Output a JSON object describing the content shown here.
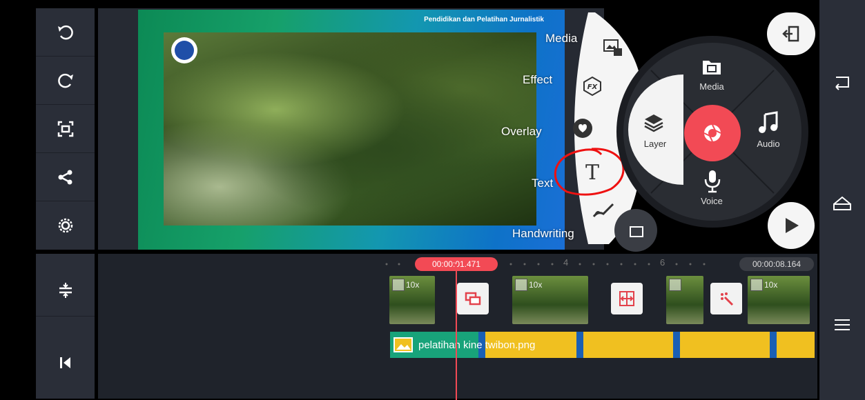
{
  "preview": {
    "title": "Pendidikan dan Pelatihan Jurnalistik"
  },
  "left_toolbar": {
    "items": [
      "undo-icon",
      "redo-icon",
      "crop-icon",
      "share-icon",
      "settings-icon",
      "align-icon",
      "skip-start-icon"
    ]
  },
  "arc_menu": {
    "media": "Media",
    "effect": "Effect",
    "overlay": "Overlay",
    "text": "Text",
    "handwriting": "Handwriting"
  },
  "main_menu": {
    "media": "Media",
    "audio": "Audio",
    "voice": "Voice",
    "layer": "Layer"
  },
  "timeline": {
    "current_time": "00:00:01.471",
    "total_time": "00:00:08.164",
    "marker_4": "4",
    "marker_6": "6",
    "clip_speed": "10x",
    "layer_name": "pelatihan kine twibon.png"
  },
  "colors": {
    "accent": "#f24a55",
    "layer_track": "#f0c020",
    "panel": "#2a2e38"
  }
}
